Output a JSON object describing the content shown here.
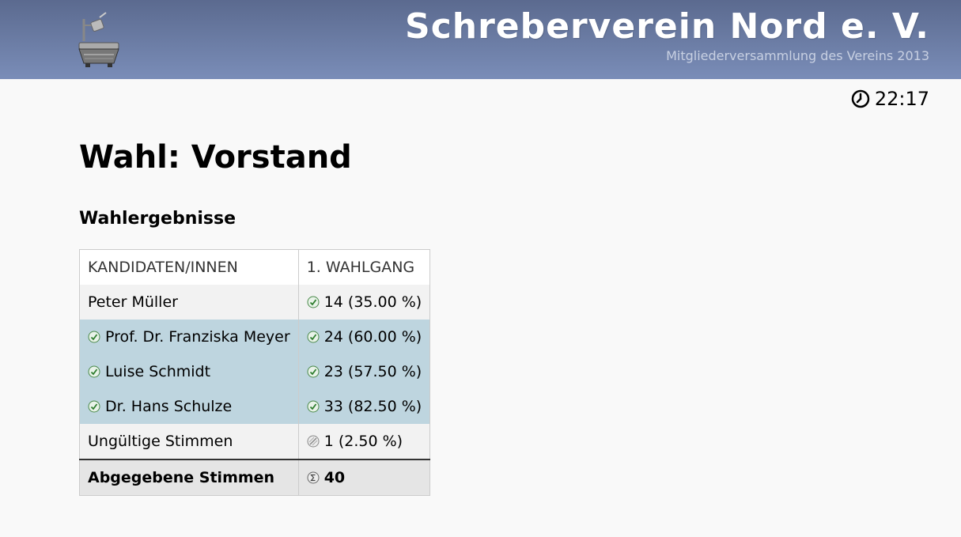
{
  "header": {
    "title": "Schreberverein Nord e. V.",
    "subtitle": "Mitgliederversammlung des Vereins 2013",
    "logo_icon": "projector-logo-icon"
  },
  "clock": {
    "icon": "clock-icon",
    "time": "22:17"
  },
  "page": {
    "title": "Wahl: Vorstand",
    "section_title": "Wahlergebnisse"
  },
  "table": {
    "headers": [
      "KANDIDATEN/INNEN",
      "1. WAHLGANG"
    ],
    "rows": [
      {
        "name": "Peter Müller",
        "elected": false,
        "result": "14 (35.00 %)",
        "result_icon": "check-icon"
      },
      {
        "name": "Prof. Dr. Franziska Meyer",
        "elected": true,
        "result": "24 (60.00 %)",
        "result_icon": "check-icon"
      },
      {
        "name": "Luise Schmidt",
        "elected": true,
        "result": "23 (57.50 %)",
        "result_icon": "check-icon"
      },
      {
        "name": "Dr. Hans Schulze",
        "elected": true,
        "result": "33 (82.50 %)",
        "result_icon": "check-icon"
      }
    ],
    "invalid": {
      "label": "Ungültige Stimmen",
      "value": "1 (2.50 %)",
      "icon": "invalid-icon"
    },
    "total": {
      "label": "Abgegebene Stimmen",
      "value": "40",
      "icon": "sum-icon"
    }
  },
  "colors": {
    "header_top": "#5b6a8f",
    "header_bottom": "#7a8db8",
    "elected_row": "#bed5df",
    "check_green": "#3a8a3a"
  }
}
